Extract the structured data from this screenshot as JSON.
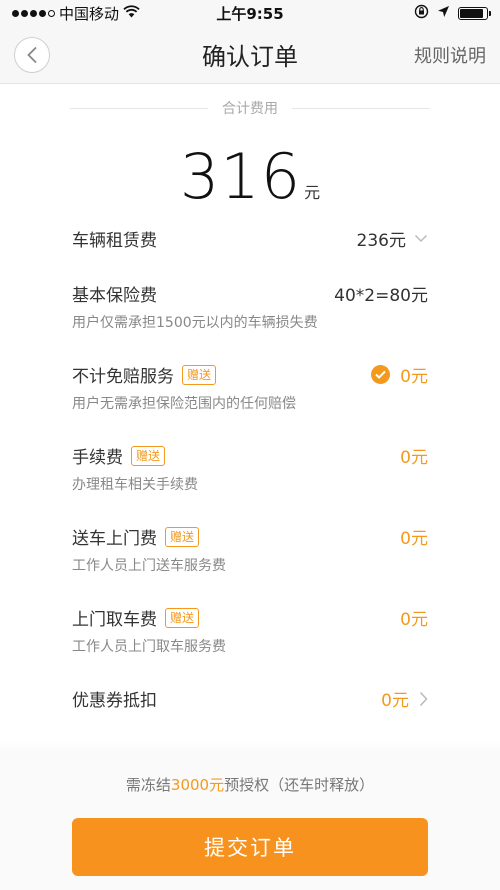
{
  "status_bar": {
    "carrier": "中国移动",
    "time": "上午9:55",
    "icons": [
      "signal-dots-icon",
      "wifi-icon",
      "rotation-lock-icon",
      "location-arrow-icon",
      "battery-icon"
    ]
  },
  "nav": {
    "back_icon": "chevron-left-icon",
    "title": "确认订单",
    "right_link": "规则说明"
  },
  "total": {
    "label": "合计费用",
    "amount": "316",
    "unit": "元"
  },
  "fees": [
    {
      "name": "车辆租赁费",
      "badge": "",
      "value": "236元",
      "desc": "",
      "icon": "chevron-down-icon"
    },
    {
      "name": "基本保险费",
      "badge": "",
      "value": "40*2=80元",
      "desc": "用户仅需承担1500元以内的车辆损失费"
    },
    {
      "name": "不计免赔服务",
      "badge": "赠送",
      "value": "0元",
      "desc": "用户无需承担保险范围内的任何赔偿",
      "icon": "check-circle-icon"
    },
    {
      "name": "手续费",
      "badge": "赠送",
      "value": "0元",
      "desc": "办理租车相关手续费"
    },
    {
      "name": "送车上门费",
      "badge": "赠送",
      "value": "0元",
      "desc": "工作人员上门送车服务费"
    },
    {
      "name": "上门取车费",
      "badge": "赠送",
      "value": "0元",
      "desc": "工作人员上门取车服务费"
    },
    {
      "name": "优惠券抵扣",
      "badge": "",
      "value": "0元",
      "desc": "",
      "icon": "chevron-right-icon"
    }
  ],
  "bottom": {
    "auth_prefix": "需冻结",
    "auth_amount": "3000元",
    "auth_suffix": "预授权（还车时释放）",
    "submit_label": "提交订单"
  },
  "colors": {
    "accent": "#f39a1e",
    "button": "#f7921e"
  }
}
